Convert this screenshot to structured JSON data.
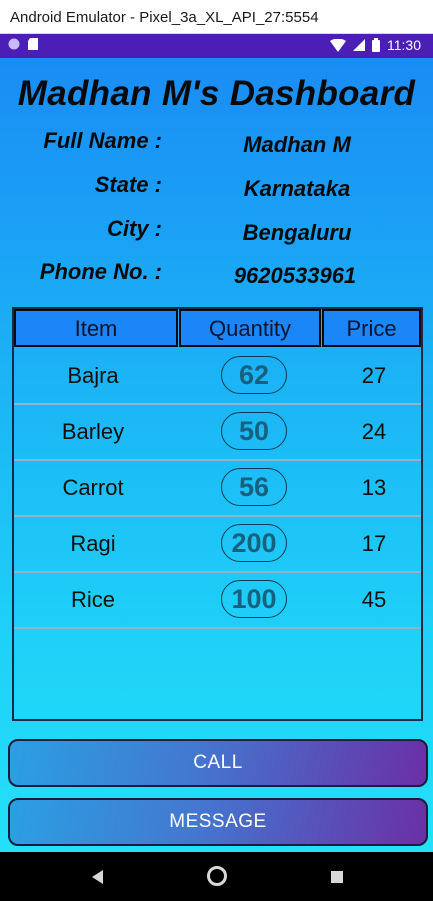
{
  "window": {
    "title": "Android Emulator - Pixel_3a_XL_API_27:5554"
  },
  "status_bar": {
    "time": "11:30"
  },
  "dashboard": {
    "title": "Madhan M's Dashboard",
    "info": [
      {
        "label": "Full Name :",
        "value": "Madhan M"
      },
      {
        "label": "State :",
        "value": "Karnataka"
      },
      {
        "label": "City :",
        "value": "Bengaluru"
      },
      {
        "label": "Phone No. :",
        "value": "9620533961"
      }
    ]
  },
  "table": {
    "headers": [
      "Item",
      "Quantity",
      "Price"
    ],
    "rows": [
      {
        "item": "Bajra",
        "quantity": "62",
        "price": "27"
      },
      {
        "item": "Barley",
        "quantity": "50",
        "price": "24"
      },
      {
        "item": "Carrot",
        "quantity": "56",
        "price": "13"
      },
      {
        "item": "Ragi",
        "quantity": "200",
        "price": "17"
      },
      {
        "item": "Rice",
        "quantity": "100",
        "price": "45"
      }
    ]
  },
  "actions": {
    "call_label": "CALL",
    "message_label": "MESSAGE"
  },
  "colors": {
    "status_bar": "#4b1fb6",
    "header_cell": "#1a86f7",
    "button_start": "#2aa0e4",
    "button_end": "#6a2fa6"
  }
}
